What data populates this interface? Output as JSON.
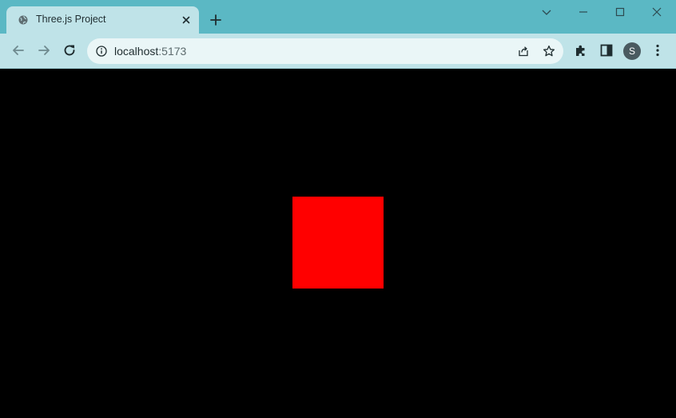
{
  "tab": {
    "title": "Three.js Project",
    "favicon": "globe-icon"
  },
  "window_controls": [
    "chevron-down-icon",
    "minimize-icon",
    "maximize-icon",
    "close-icon"
  ],
  "address_bar": {
    "host": "localhost",
    "port": ":5173"
  },
  "profile": {
    "initial": "S"
  },
  "scene": {
    "background": "#000000",
    "cube_color": "#ff0000"
  },
  "colors": {
    "frame": "#5bb8c4",
    "toolbar": "#bfe3e8"
  }
}
